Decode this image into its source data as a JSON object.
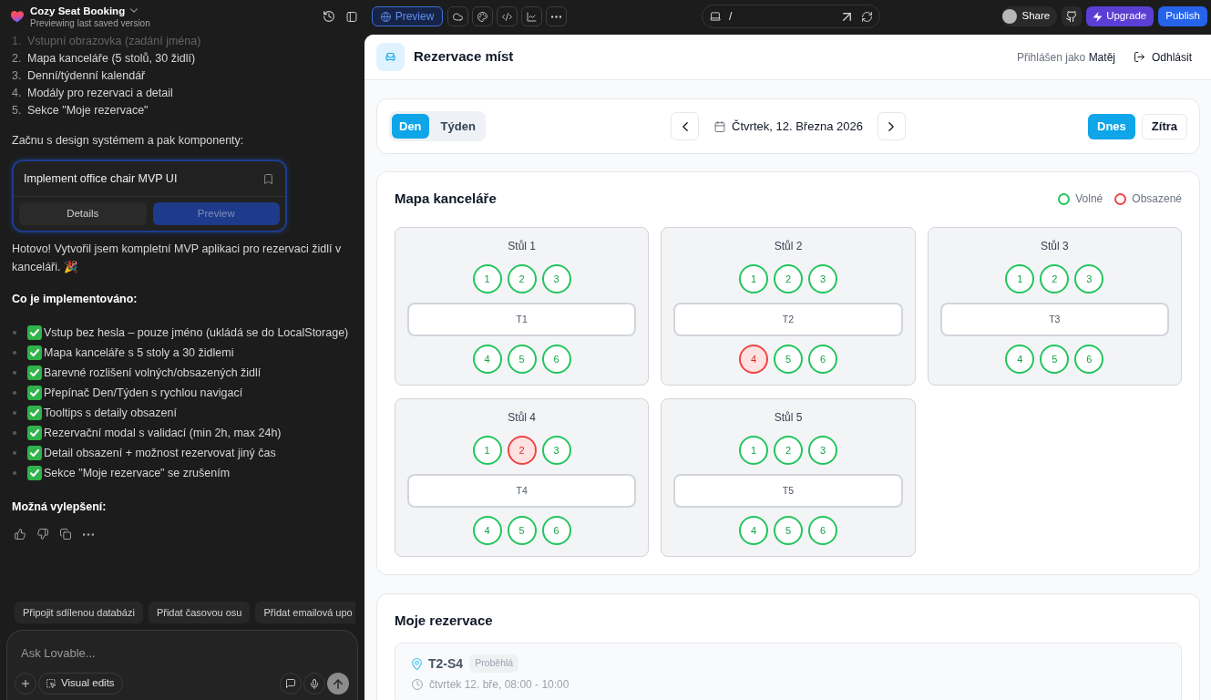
{
  "top_bar": {
    "project_name": "Cozy Seat Booking",
    "subtitle": "Previewing last saved version",
    "preview_button": "Preview",
    "address": "/",
    "share_button": "Share",
    "upgrade_button": "Upgrade",
    "publish_button": "Publish"
  },
  "chat": {
    "plan_items": [
      {
        "number": "1.",
        "text": "Vstupní obrazovka (zadání jména)"
      },
      {
        "number": "2.",
        "text": "Mapa kanceláře (5 stolů, 30 židlí)"
      },
      {
        "number": "3.",
        "text": "Denní/týdenní kalendář"
      },
      {
        "number": "4.",
        "text": "Modály pro rezervaci a detail"
      },
      {
        "number": "5.",
        "text": "Sekce \"Moje rezervace\""
      }
    ],
    "intro": "Začnu s design systémem a pak komponenty:",
    "task_card": {
      "title": "Implement office chair MVP UI",
      "tabs": [
        {
          "label": "Details",
          "selected": false
        },
        {
          "label": "Preview",
          "selected": true
        }
      ]
    },
    "summary": "Hotovo! Vytvořil jsem kompletní MVP aplikaci pro rezervaci židlí v kanceláři. 🎉",
    "implemented_heading": "Co je implementováno:",
    "implemented_items": [
      "Vstup bez hesla – pouze jméno (ukládá se do LocalStorage)",
      "Mapa kanceláře s 5 stoly a 30 židlemi",
      "Barevné rozlišení volných/obsazených židlí",
      "Přepínač Den/Týden s rychlou navigací",
      "Tooltips s detaily obsazení",
      "Rezervační modal s validací (min 2h, max 24h)",
      "Detail obsazení + možnost rezervovat jiný čas",
      "Sekce \"Moje rezervace\" se zrušením"
    ],
    "improvements_heading": "Možná vylepšení:",
    "suggestions": [
      "Připojit sdílenou databázi",
      "Přidat časovou osu",
      "Přidat emailová upo"
    ],
    "input": {
      "placeholder": "Ask Lovable..."
    },
    "visual_edits_button": "Visual edits"
  },
  "app": {
    "title": "Rezervace míst",
    "user": "Přihlášen jako **Matěj**",
    "logout_button": "Odhlásit",
    "view_tabs": [
      {
        "label": "Den",
        "selected": true
      },
      {
        "label": "Týden",
        "selected": false
      }
    ],
    "date": "Čtvrtek, 12. Března 2026",
    "quick_days": [
      {
        "label": "Dnes",
        "selected": true
      },
      {
        "label": "Zítra",
        "selected": false
      }
    ],
    "map": {
      "title": "Mapa kanceláře",
      "legend": [
        {
          "label": "Volné",
          "color": "#22c55e"
        },
        {
          "label": "Obsazené",
          "color": "#ef4444"
        }
      ],
      "desks": [
        {
          "name": "Stůl 1",
          "table": "T1",
          "top_seats": [
            {
              "number": "1",
              "occupied": false
            },
            {
              "number": "2",
              "occupied": false
            },
            {
              "number": "3",
              "occupied": false
            }
          ],
          "bottom_seats": [
            {
              "number": "4",
              "occupied": false
            },
            {
              "number": "5",
              "occupied": false
            },
            {
              "number": "6",
              "occupied": false
            }
          ]
        },
        {
          "name": "Stůl 2",
          "table": "T2",
          "top_seats": [
            {
              "number": "1",
              "occupied": false
            },
            {
              "number": "2",
              "occupied": false
            },
            {
              "number": "3",
              "occupied": false
            }
          ],
          "bottom_seats": [
            {
              "number": "4",
              "occupied": true
            },
            {
              "number": "5",
              "occupied": false
            },
            {
              "number": "6",
              "occupied": false
            }
          ]
        },
        {
          "name": "Stůl 3",
          "table": "T3",
          "top_seats": [
            {
              "number": "1",
              "occupied": false
            },
            {
              "number": "2",
              "occupied": false
            },
            {
              "number": "3",
              "occupied": false
            }
          ],
          "bottom_seats": [
            {
              "number": "4",
              "occupied": false
            },
            {
              "number": "5",
              "occupied": false
            },
            {
              "number": "6",
              "occupied": false
            }
          ]
        },
        {
          "name": "Stůl 4",
          "table": "T4",
          "top_seats": [
            {
              "number": "1",
              "occupied": false
            },
            {
              "number": "2",
              "occupied": true
            },
            {
              "number": "3",
              "occupied": false
            }
          ],
          "bottom_seats": [
            {
              "number": "4",
              "occupied": false
            },
            {
              "number": "5",
              "occupied": false
            },
            {
              "number": "6",
              "occupied": false
            }
          ]
        },
        {
          "name": "Stůl 5",
          "table": "T5",
          "top_seats": [
            {
              "number": "1",
              "occupied": false
            },
            {
              "number": "2",
              "occupied": false
            },
            {
              "number": "3",
              "occupied": false
            }
          ],
          "bottom_seats": [
            {
              "number": "4",
              "occupied": false
            },
            {
              "number": "5",
              "occupied": false
            },
            {
              "number": "6",
              "occupied": false
            }
          ]
        }
      ]
    },
    "reservations": {
      "title": "Moje rezervace",
      "items": [
        {
          "seat": "T2-S4",
          "status": "Proběhlá",
          "time": "čtvrtek 12. bře, 08:00 - 10:00"
        }
      ]
    }
  }
}
